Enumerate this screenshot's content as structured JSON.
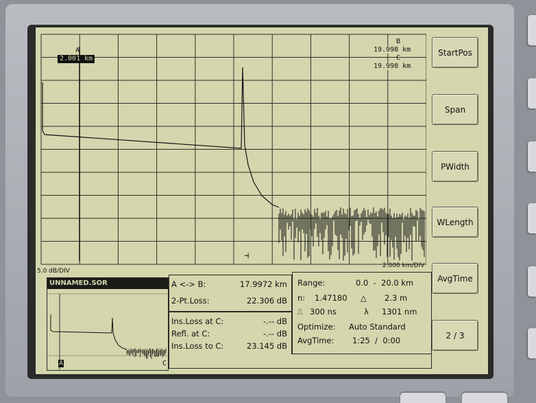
{
  "markers": {
    "a_label": "A",
    "a_value": "2.001 km",
    "b_label": "B",
    "b_value": "19.998 km",
    "c_label": "C",
    "c_value": "19.998 km",
    "bottom_a": "A",
    "bottom_c": "C"
  },
  "scale": {
    "vertical": "5.0 dB/DIV",
    "horizontal": "2.000 km/DIV"
  },
  "softkeys": [
    {
      "label": "StartPos"
    },
    {
      "label": "Span"
    },
    {
      "label": "PWidth"
    },
    {
      "label": "WLength"
    },
    {
      "label": "AvgTime"
    },
    {
      "label": "2 / 3"
    }
  ],
  "thumbnail": {
    "title": "UNNAMED.SOR"
  },
  "measurements": {
    "ab_label": "A <-> B:",
    "ab_value": "17.9972 km",
    "two_pt_loss_label": "2-Pt.Loss:",
    "two_pt_loss_value": "22.306 dB",
    "ins_loss_c_label": "Ins.Loss at C:",
    "ins_loss_c_value": "-.-- dB",
    "refl_c_label": "Refl. at C:",
    "refl_c_value": "-.-- dB",
    "ins_loss_to_c_label": "Ins.Loss to C:",
    "ins_loss_to_c_value": "23.145 dB"
  },
  "settings": {
    "range_label": "Range:",
    "range_value": "0.0  -  20.0 km",
    "n_label": "n:",
    "n_value": "1.47180",
    "delta_symbol": "△",
    "delta_value": "2.3 m",
    "pulse_symbol": "⎍",
    "pulse_value": "300 ns",
    "lambda_symbol": "λ",
    "lambda_value": "1301 nm",
    "optimize_label": "Optimize:",
    "optimize_value": "Auto Standard",
    "avgtime_label": "AvgTime:",
    "avgtime_value": "1:25  /  0:00"
  },
  "colors": {
    "lcd_background": "#d4d6ad",
    "lcd_foreground": "#111111",
    "bezel": "#2a2b2a",
    "case": "#b0b3b8"
  }
}
